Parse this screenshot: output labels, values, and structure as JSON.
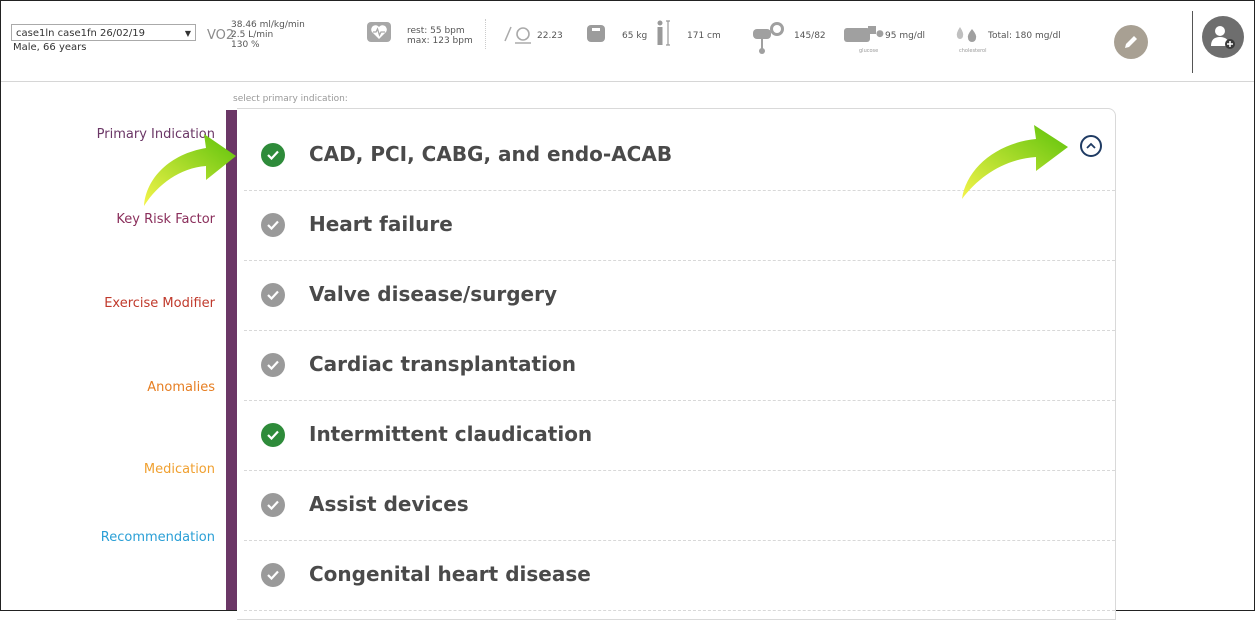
{
  "header": {
    "patient_select": "case1ln case1fn 26/02/19",
    "patient_sub": "Male, 66 years",
    "vo2_label": "VO2",
    "vo2_ml": "38.46 ml/kg/min",
    "vo2_l": "2.5 L/min",
    "vo2_pct": "130 %",
    "hr_rest": "rest: 55 bpm",
    "hr_max": "max: 123 bpm",
    "bmi": "22.23",
    "weight": "65 kg",
    "height": "171 cm",
    "bp": "145/82",
    "glucose": "95 mg/dl",
    "glucose_caption": "glucose",
    "cholesterol": "Total: 180 mg/dl",
    "cholesterol_caption": "cholesterol"
  },
  "sidebar": {
    "items": [
      {
        "label": "Primary Indication",
        "color": "#6b3766"
      },
      {
        "label": "Key Risk Factor",
        "color": "#8a2e5b"
      },
      {
        "label": "Exercise Modifier",
        "color": "#c0392b"
      },
      {
        "label": "Anomalies",
        "color": "#e67e22"
      },
      {
        "label": "Medication",
        "color": "#f0a030"
      },
      {
        "label": "Recommendation",
        "color": "#2a9fd6"
      }
    ]
  },
  "main": {
    "hint": "select primary indication:",
    "items": [
      {
        "label": "CAD, PCI, CABG, and endo-ACAB",
        "selected": true
      },
      {
        "label": "Heart failure",
        "selected": false
      },
      {
        "label": "Valve disease/surgery",
        "selected": false
      },
      {
        "label": "Cardiac transplantation",
        "selected": false
      },
      {
        "label": "Intermittent claudication",
        "selected": true
      },
      {
        "label": "Assist devices",
        "selected": false
      },
      {
        "label": "Congenital heart disease",
        "selected": false
      }
    ]
  },
  "colors": {
    "selected": "#2e8b3a",
    "unselected": "#9a9a9a",
    "accent_bar": "#6b3766",
    "arrow": "#7ed321"
  }
}
